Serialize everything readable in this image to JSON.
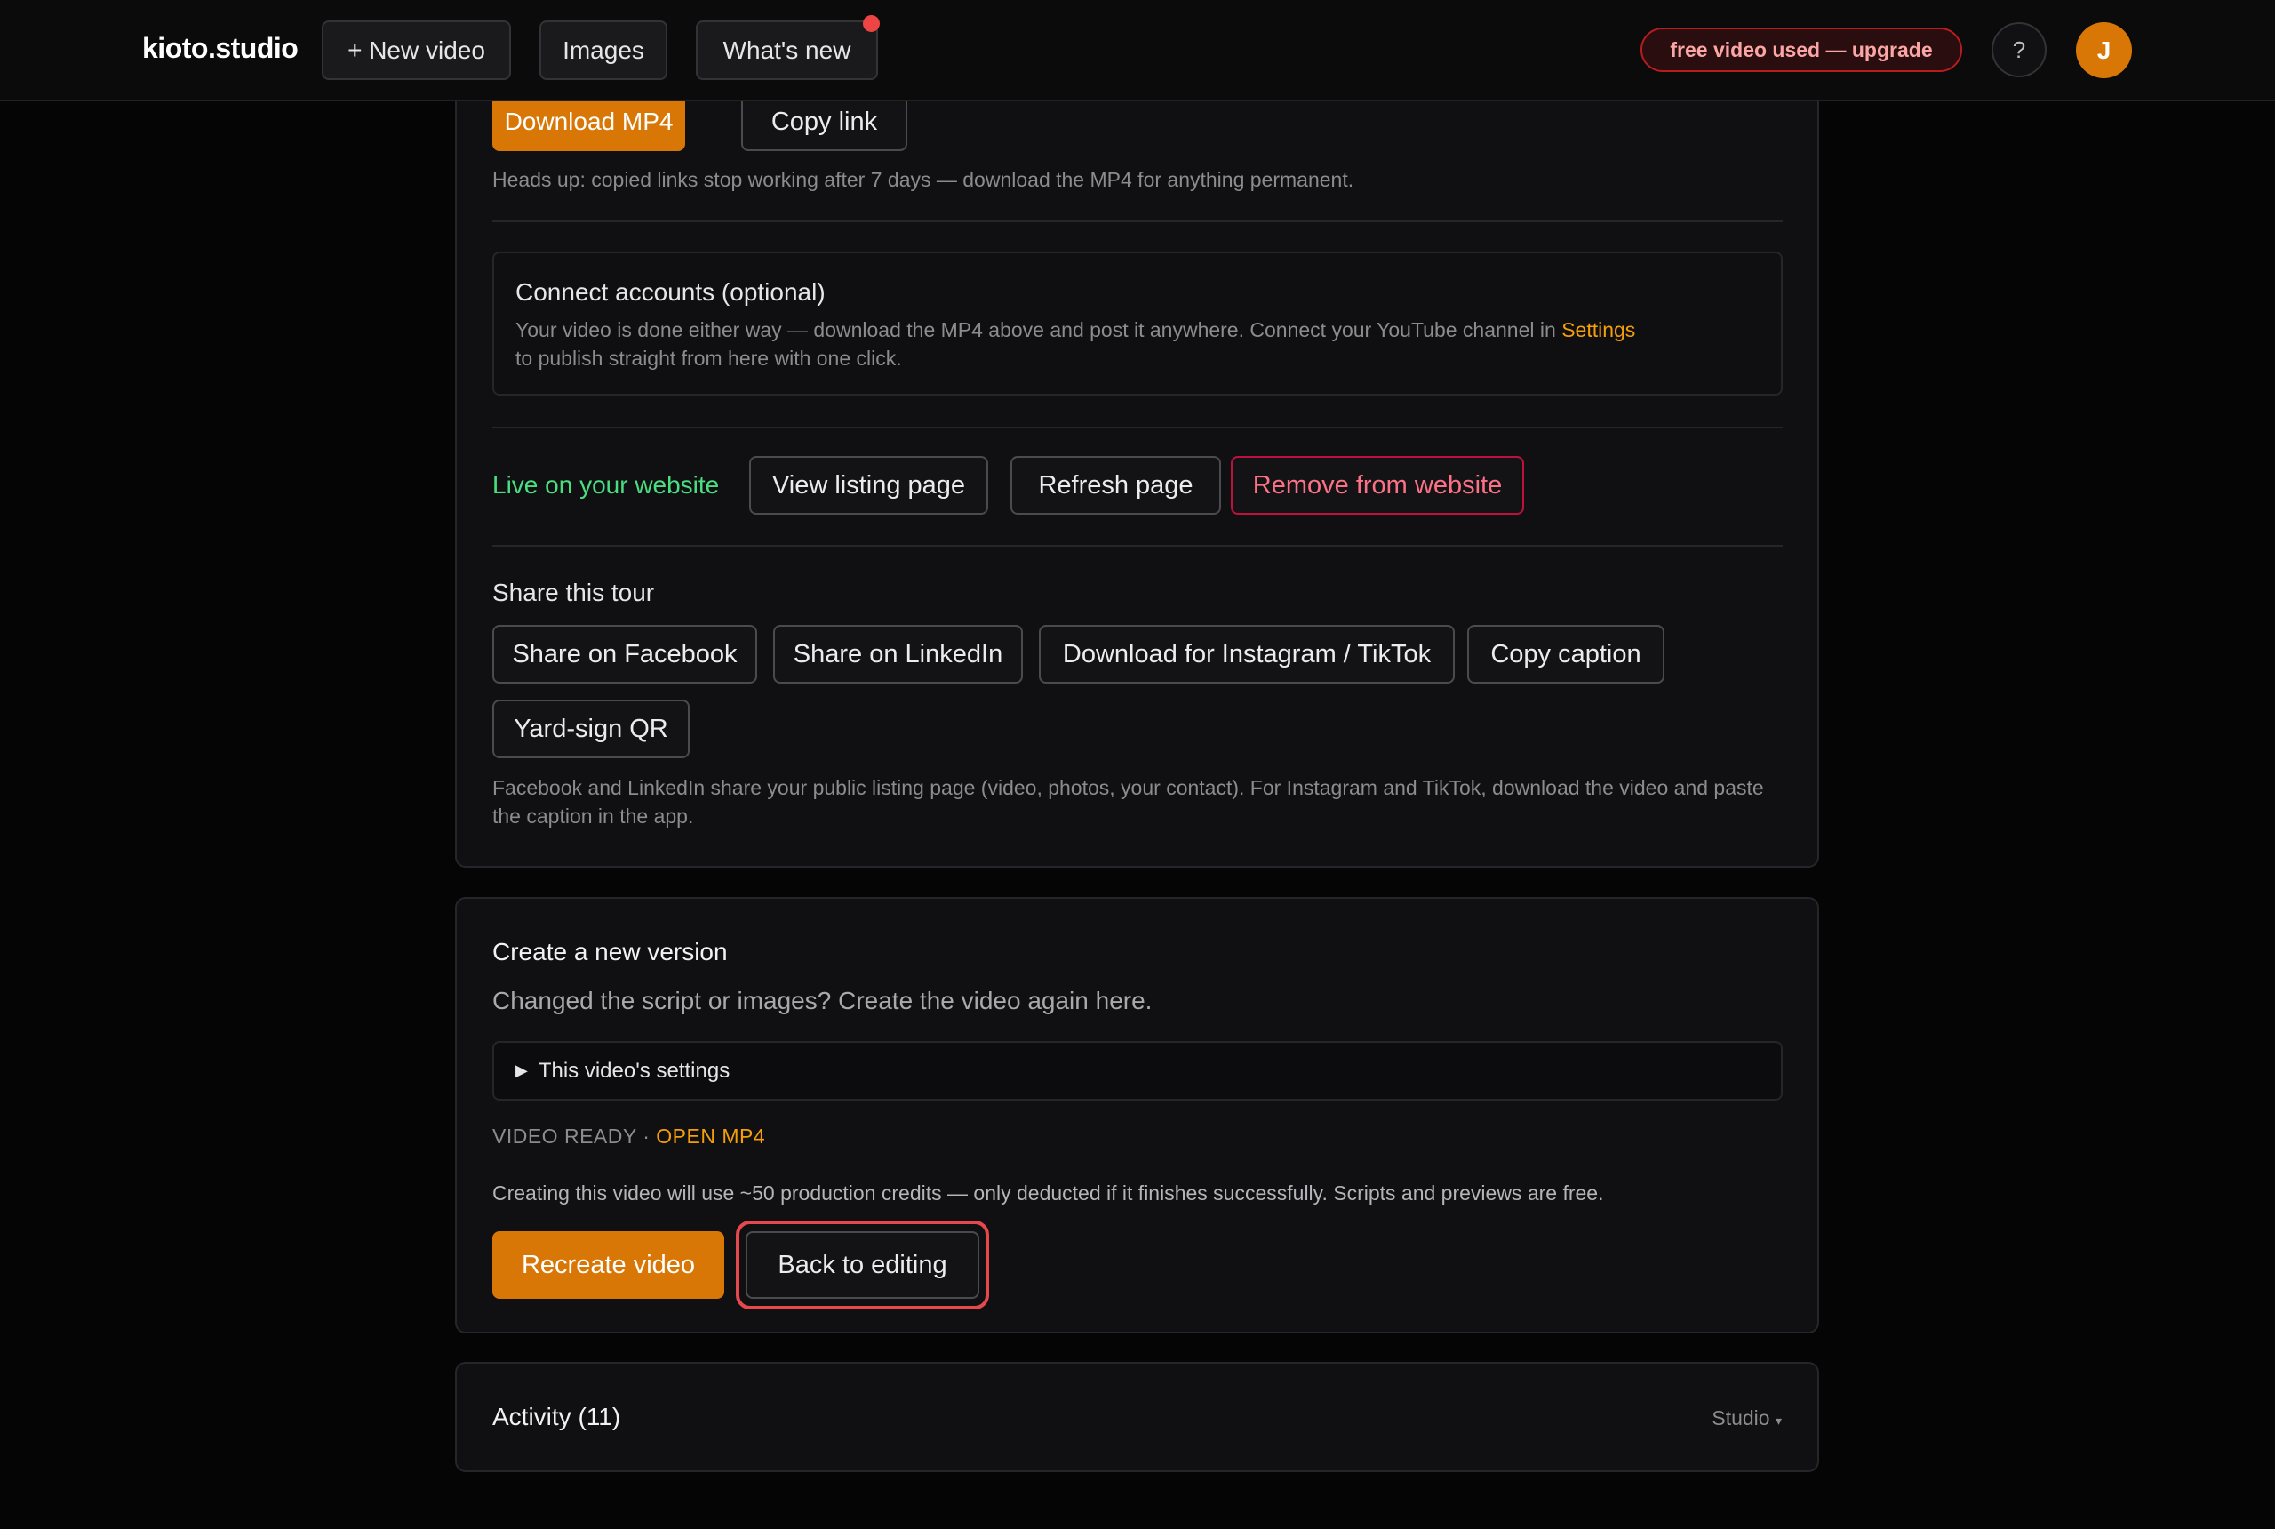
{
  "topbar": {
    "brand": "kioto.studio",
    "new_video": "+ New video",
    "images": "Images",
    "whats_new": "What's new",
    "upgrade": "free video used — upgrade",
    "help": "?",
    "avatar_initial": "J"
  },
  "export": {
    "download_mp4": "Download MP4",
    "copy_link": "Copy link",
    "heads_up": "Heads up: copied links stop working after 7 days — download the MP4 for anything permanent.",
    "connect_title": "Connect accounts (optional)",
    "connect_text_before": "Your video is done either way — download the MP4 above and post it anywhere. Connect your YouTube channel in ",
    "connect_settings_link": "Settings",
    "connect_text_after": "to publish straight from here with one click.",
    "live_status": "Live on your website",
    "view_listing": "View listing page",
    "refresh_page": "Refresh page",
    "remove_from_website": "Remove from website",
    "share_title": "Share this tour",
    "share_buttons": [
      "Share on Facebook",
      "Share on LinkedIn",
      "Download for Instagram / TikTok",
      "Copy caption",
      "Yard-sign QR"
    ],
    "share_note": "Facebook and LinkedIn share your public listing page (video, photos, your contact). For Instagram and TikTok, download the video and paste the caption in the app."
  },
  "new_version": {
    "title": "Create a new version",
    "subtitle": "Changed the script or images? Create the video again here.",
    "settings_toggle": "This video's settings",
    "status_label": "VIDEO READY",
    "status_sep": "·",
    "open_mp4": "OPEN MP4",
    "credits_note": "Creating this video will use ~50 production credits — only deducted if it finishes successfully. Scripts and previews are free.",
    "recreate": "Recreate video",
    "back_to_editing": "Back to editing"
  },
  "activity": {
    "title": "Activity (11)",
    "filter": "Studio",
    "filter_caret": "▾"
  },
  "colors": {
    "accent": "#d97706",
    "live_green": "#4ade80",
    "danger": "#fb7185",
    "link": "#f59e0b"
  }
}
